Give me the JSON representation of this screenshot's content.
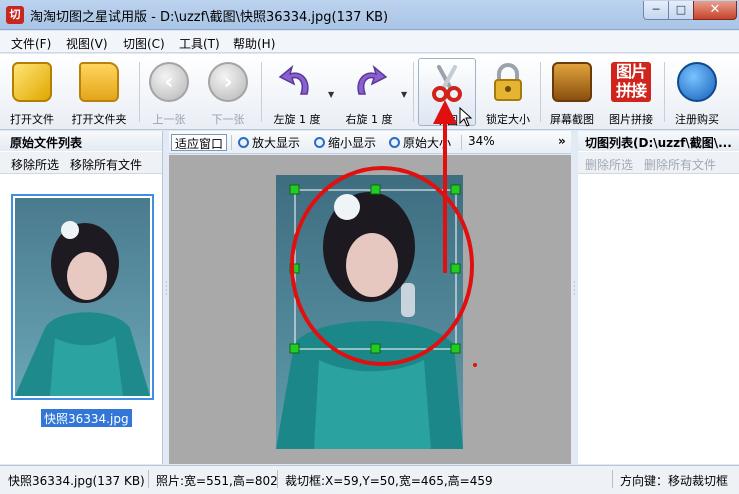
{
  "window": {
    "app_icon_text": "切",
    "title": "淘淘切图之星试用版 - D:\\uzzf\\截图\\快照36334.jpg(137 KB)",
    "min_glyph": "─",
    "max_glyph": "□",
    "close_glyph": "✕"
  },
  "menu": [
    "文件(F)",
    "视图(V)",
    "切图(C)",
    "工具(T)",
    "帮助(H)"
  ],
  "toolbar": {
    "open_file": "打开文件",
    "open_folder": "打开文件夹",
    "prev": "上一张",
    "next": "下一张",
    "rotate_left": "左旋 1 度",
    "rotate_right": "右旋 1 度",
    "cut": "切图",
    "lock_size": "锁定大小",
    "screen_capture": "屏幕截图",
    "stitch": "图片拼接",
    "stitch_icon_text": [
      "图片",
      "拼接"
    ],
    "buy": "注册购买"
  },
  "left_panel": {
    "title": "原始文件列表",
    "remove_selected": "移除所选",
    "remove_all": "移除所有文件",
    "file_caption": "快照36334.jpg"
  },
  "view_toolbar": {
    "fit_window": "适应窗口",
    "zoom_in": "放大显示",
    "zoom_out": "缩小显示",
    "original_size": "原始大小",
    "zoom_level": "34%",
    "more": "»"
  },
  "right_panel": {
    "title": "切图列表(D:\\uzzf\\截图\\...",
    "delete_selected": "删除所选",
    "delete_all": "删除所有文件"
  },
  "status": {
    "file": "快照36334.jpg(137 KB)",
    "photo": "照片:宽=551,高=802",
    "crop": "裁切框:X=59,Y=50,宽=465,高=459",
    "hint": "方向键：移动裁切框"
  },
  "colors": {
    "annotation_red": "#e01010",
    "handle_green": "#22cc22",
    "selection_blue": "#3277d8"
  }
}
